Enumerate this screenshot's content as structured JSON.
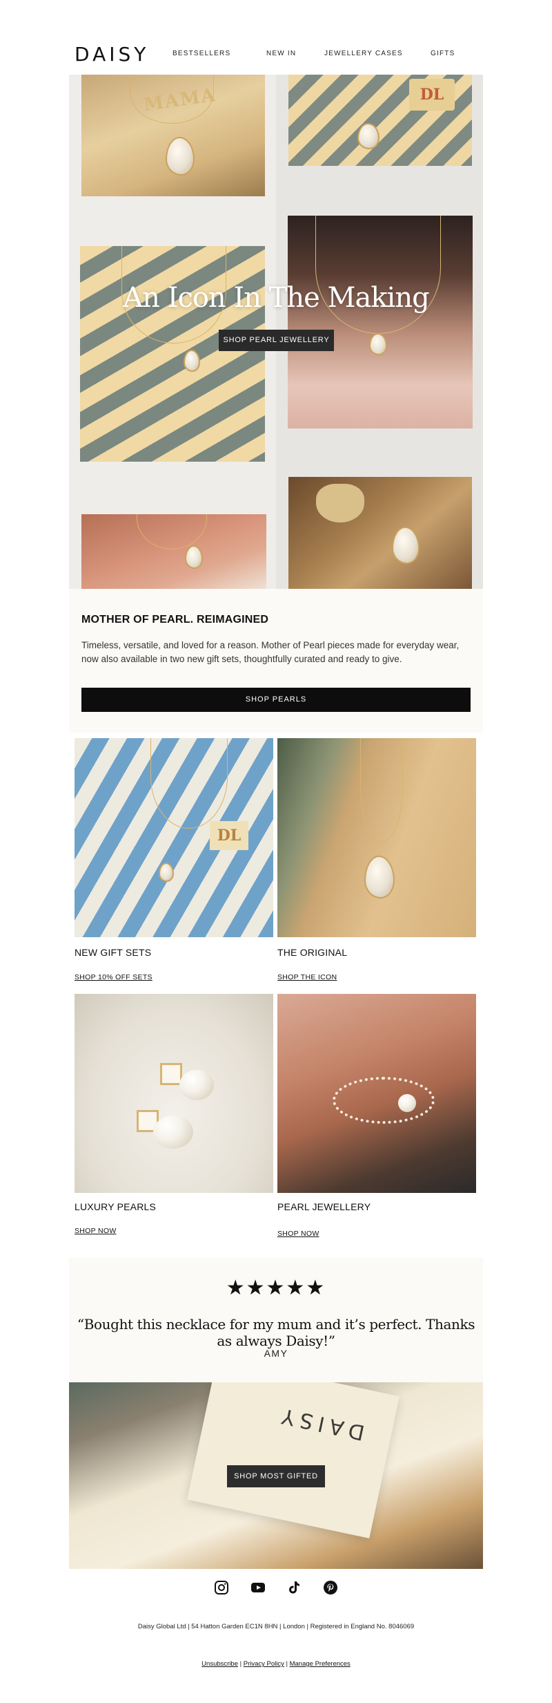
{
  "brand": {
    "logo": "DAISY"
  },
  "nav": {
    "items": [
      {
        "label": "BESTSELLERS"
      },
      {
        "label": "NEW IN"
      },
      {
        "label": "JEWELLERY CASES"
      },
      {
        "label": "GIFTS"
      }
    ]
  },
  "hero": {
    "title": "An Icon In The Making",
    "button_label": "SHOP PEARL JEWELLERY",
    "image_text": {
      "mama": "MAMA",
      "dl": "DL"
    }
  },
  "intro": {
    "heading": "MOTHER OF PEARL. REIMAGINED",
    "body": "Timeless, versatile, and loved for a reason. Mother of Pearl pieces made for everyday wear, now also available in two new gift sets, thoughtfully curated and ready to give.",
    "button_label": "SHOP PEARLS"
  },
  "products": [
    {
      "title": "NEW GIFT SETS",
      "link": "SHOP 10% OFF SETS",
      "image_text": "DL"
    },
    {
      "title": "THE ORIGINAL",
      "link": "SHOP THE ICON"
    },
    {
      "title": "LUXURY PEARLS",
      "link": "SHOP NOW"
    },
    {
      "title": "PEARL JEWELLERY",
      "link": "SHOP NOW"
    }
  ],
  "testimonial": {
    "stars": "★★★★★",
    "rating": 5,
    "quote": "“Bought this necklace for my mum and it’s perfect. Thanks as always Daisy!”",
    "author": "AMY"
  },
  "gift_banner": {
    "button_label": "SHOP MOST GIFTED",
    "bag_text": "DAISY"
  },
  "social": {
    "icons": [
      "instagram-icon",
      "youtube-icon",
      "tiktok-icon",
      "pinterest-icon"
    ]
  },
  "footer": {
    "address": "Daisy Global Ltd | 54 Hatton Garden EC1N 8HN | London | Registered in England No. 8046069",
    "unsubscribe": "Unsubscribe",
    "privacy": "Privacy Policy",
    "manage": "Manage Preferences",
    "separator": " | "
  }
}
